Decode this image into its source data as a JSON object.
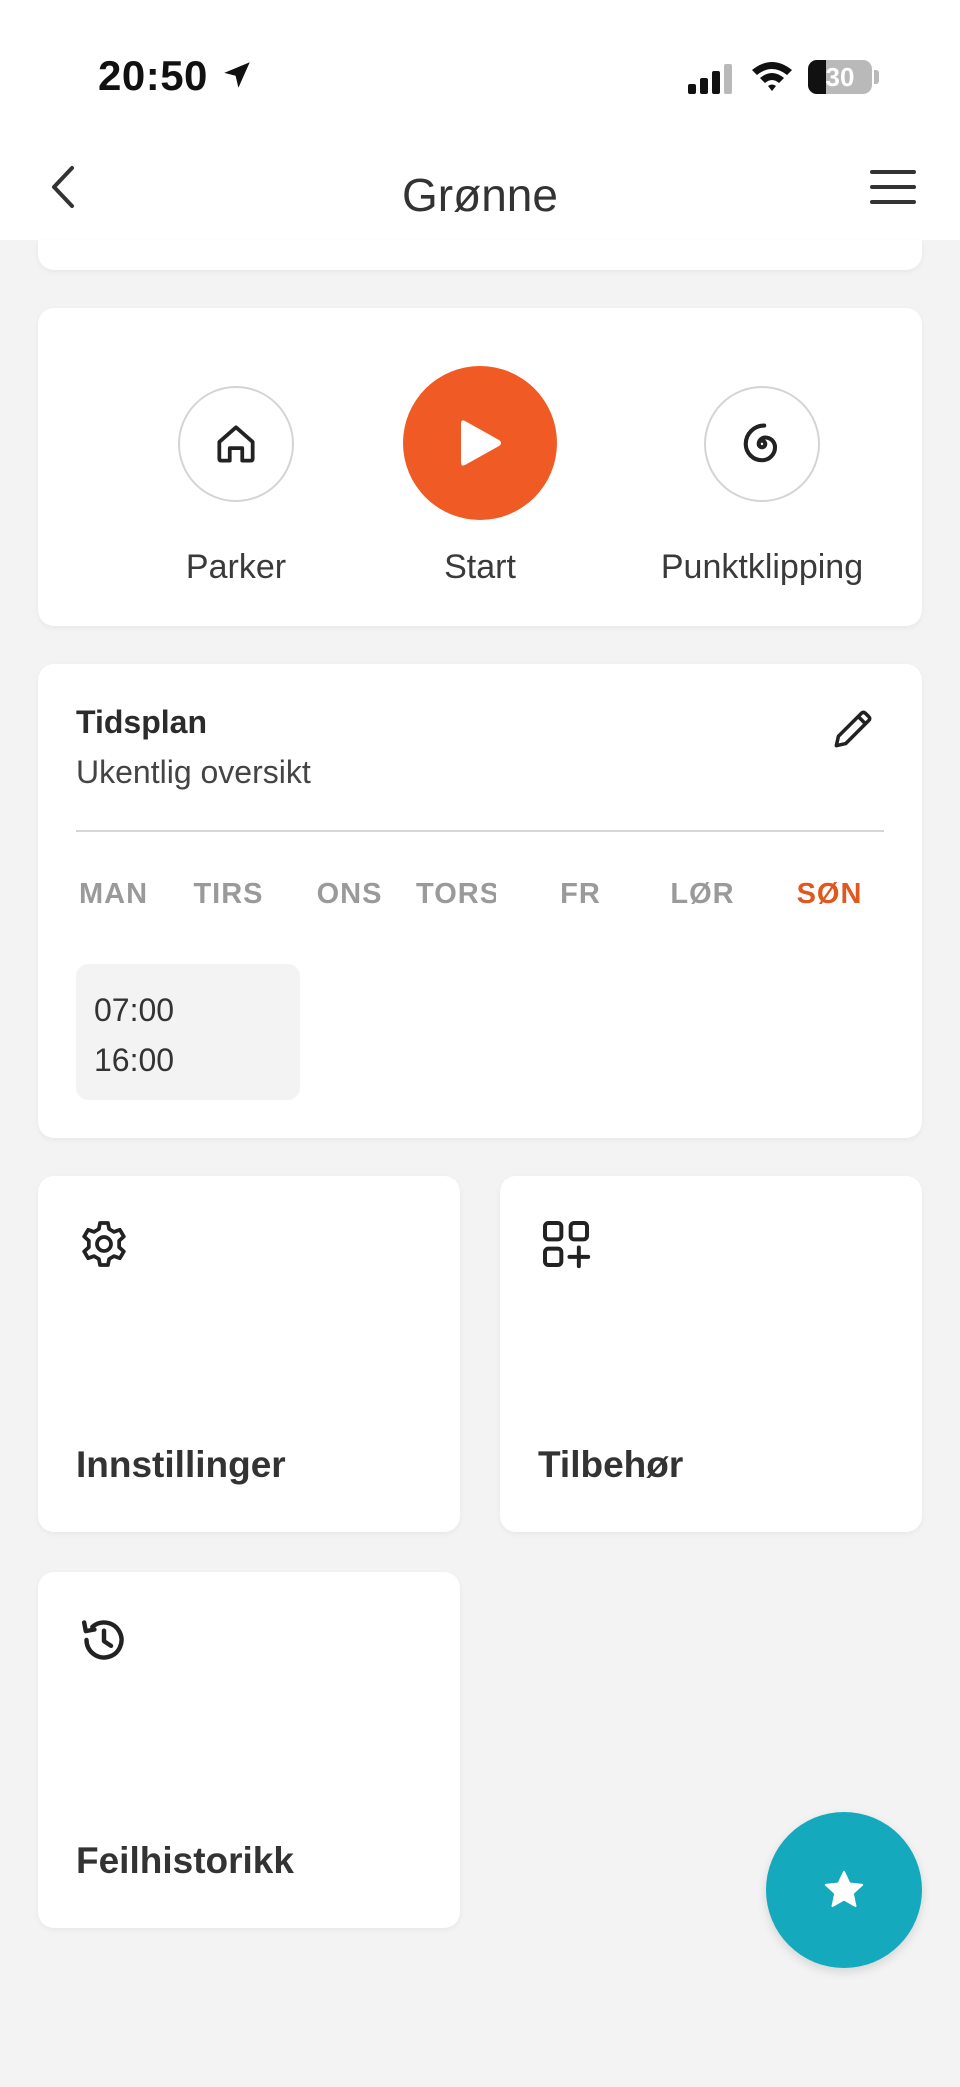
{
  "status_bar": {
    "time": "20:50",
    "battery": "30"
  },
  "nav": {
    "title": "Grønne"
  },
  "actions": [
    {
      "label": "Parker",
      "icon": "home-icon"
    },
    {
      "label": "Start",
      "icon": "play-icon"
    },
    {
      "label": "Punktklipping",
      "icon": "spiral-icon"
    }
  ],
  "schedule": {
    "title": "Tidsplan",
    "subtitle": "Ukentlig oversikt",
    "days": [
      "MAN",
      "TIRS",
      "ONS",
      "TORS",
      "FR",
      "LØR",
      "SØN"
    ],
    "active_day": "SØN",
    "slot_start": "07:00",
    "slot_end": "16:00"
  },
  "tiles": {
    "settings": "Innstillinger",
    "accessories": "Tilbehør",
    "error_history": "Feilhistorikk"
  },
  "colors": {
    "accent": "#f05a25",
    "fab": "#14a9bd",
    "background": "#f3f3f3"
  }
}
